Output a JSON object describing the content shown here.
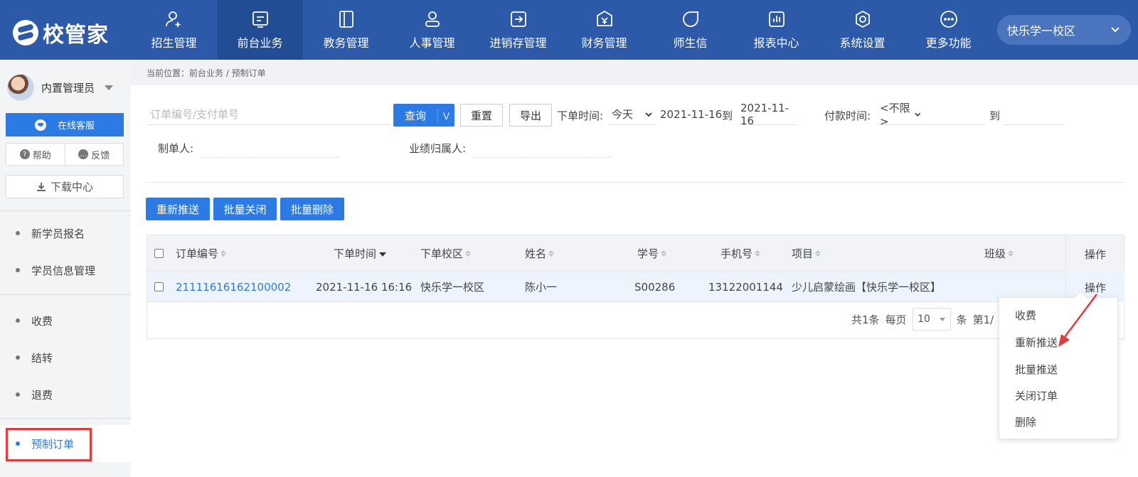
{
  "app": {
    "logo_text": "校管家"
  },
  "nav": [
    {
      "label": "招生管理",
      "icon": "user-add-icon"
    },
    {
      "label": "前台业务",
      "icon": "frontdesk-icon",
      "active": true
    },
    {
      "label": "教务管理",
      "icon": "book-icon"
    },
    {
      "label": "人事管理",
      "icon": "person-icon"
    },
    {
      "label": "进销存管理",
      "icon": "inventory-icon"
    },
    {
      "label": "财务管理",
      "icon": "finance-icon"
    },
    {
      "label": "师生信",
      "icon": "message-icon"
    },
    {
      "label": "报表中心",
      "icon": "report-icon"
    },
    {
      "label": "系统设置",
      "icon": "settings-icon"
    },
    {
      "label": "更多功能",
      "icon": "more-icon"
    }
  ],
  "campus_selector": {
    "value": "快乐学一校区"
  },
  "sidebar": {
    "username": "内置管理员",
    "online_service": "在线客服",
    "help": "帮助",
    "feedback": "反馈",
    "download_center": "下载中心",
    "items": [
      {
        "label": "新学员报名"
      },
      {
        "label": "学员信息管理"
      },
      {
        "label": "收费"
      },
      {
        "label": "结转"
      },
      {
        "label": "退费"
      },
      {
        "label": "预制订单",
        "active": true
      }
    ]
  },
  "breadcrumb": "当前位置：前台业务 / 预制订单",
  "filters": {
    "order_no_placeholder": "订单编号/支付单号",
    "query": "查询",
    "reset": "重置",
    "export": "导出",
    "order_time_label": "下单时间:",
    "order_time_preset": "今天",
    "order_time_from": "2021-11-16",
    "to": "到",
    "order_time_to": "2021-11-16",
    "pay_time_label": "付款时间:",
    "pay_time_preset": "<不限>",
    "pay_to": "到",
    "creator_label": "制单人:",
    "performance_label": "业绩归属人:"
  },
  "actions": {
    "repush": "重新推送",
    "batch_close": "批量关闭",
    "batch_delete": "批量删除"
  },
  "table": {
    "columns": [
      "订单编号",
      "下单时间",
      "下单校区",
      "姓名",
      "学号",
      "手机号",
      "项目",
      "班级",
      "操作"
    ],
    "rows": [
      {
        "order_no": "21111616162100002",
        "order_time": "2021-11-16 16:16",
        "campus": "快乐学一校区",
        "name": "陈小一",
        "student_no": "S00286",
        "phone": "13122001144",
        "project": "少儿启蒙绘画【快乐学一校区】",
        "class": "",
        "op": "操作"
      }
    ]
  },
  "pager": {
    "total": "共1条",
    "per_page_label": "每页",
    "per_page": "10",
    "unit": "条",
    "page": "第1/"
  },
  "op_menu": [
    "收费",
    "重新推送",
    "批量推送",
    "关闭订单",
    "删除"
  ]
}
